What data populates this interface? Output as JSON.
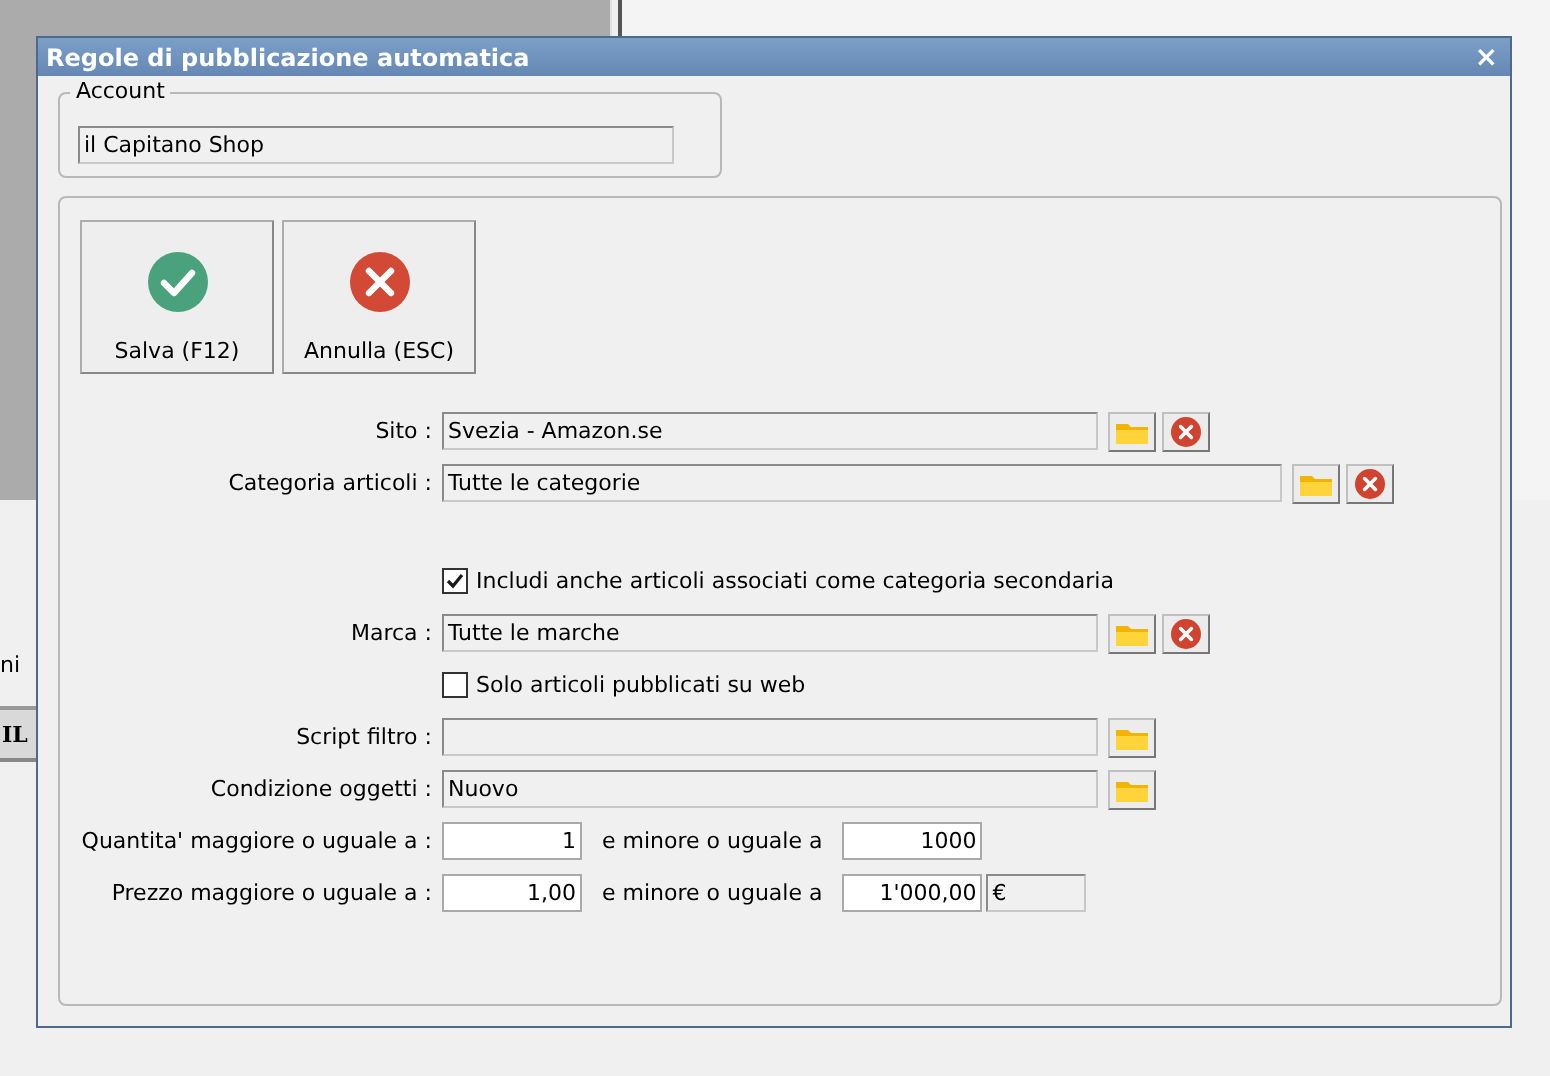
{
  "background": {
    "text_1": "ni",
    "text_2": "IL"
  },
  "window": {
    "title": "Regole di pubblicazione automatica",
    "close": "×"
  },
  "account": {
    "legend": "Account",
    "value": "il Capitano Shop"
  },
  "buttons": [
    {
      "kind": "save",
      "label": "Salva (F12)"
    },
    {
      "kind": "cancel",
      "label": "Annulla (ESC)"
    }
  ],
  "rows": [
    {
      "kind": "lookup",
      "label": "Sito :",
      "value": "Svezia - Amazon.se",
      "clear": true
    },
    {
      "kind": "lookup_wide",
      "label": "Categoria articoli :",
      "value": "Tutte le categorie",
      "clear": true
    },
    {
      "kind": "checkbox",
      "label": "Includi anche articoli associati come categoria secondaria",
      "checked": true
    },
    {
      "kind": "lookup",
      "label": "Marca :",
      "value": "Tutte le marche",
      "clear": true
    },
    {
      "kind": "checkbox",
      "label": "Solo articoli pubblicati su web",
      "checked": false
    },
    {
      "kind": "lookup",
      "label": "Script filtro :",
      "clear": false
    },
    {
      "kind": "lookup",
      "label": "Condizione oggetti :",
      "value": "Nuovo",
      "clear": false
    },
    {
      "kind": "range",
      "label": "Quantita' maggiore o uguale a :",
      "from": "1",
      "between": "e minore o uguale a",
      "to": "1000"
    },
    {
      "kind": "range",
      "label": "Prezzo maggiore o uguale a :",
      "from": "1,00",
      "between": "e minore o uguale a",
      "to": "1'000,00",
      "unit": "€"
    }
  ]
}
